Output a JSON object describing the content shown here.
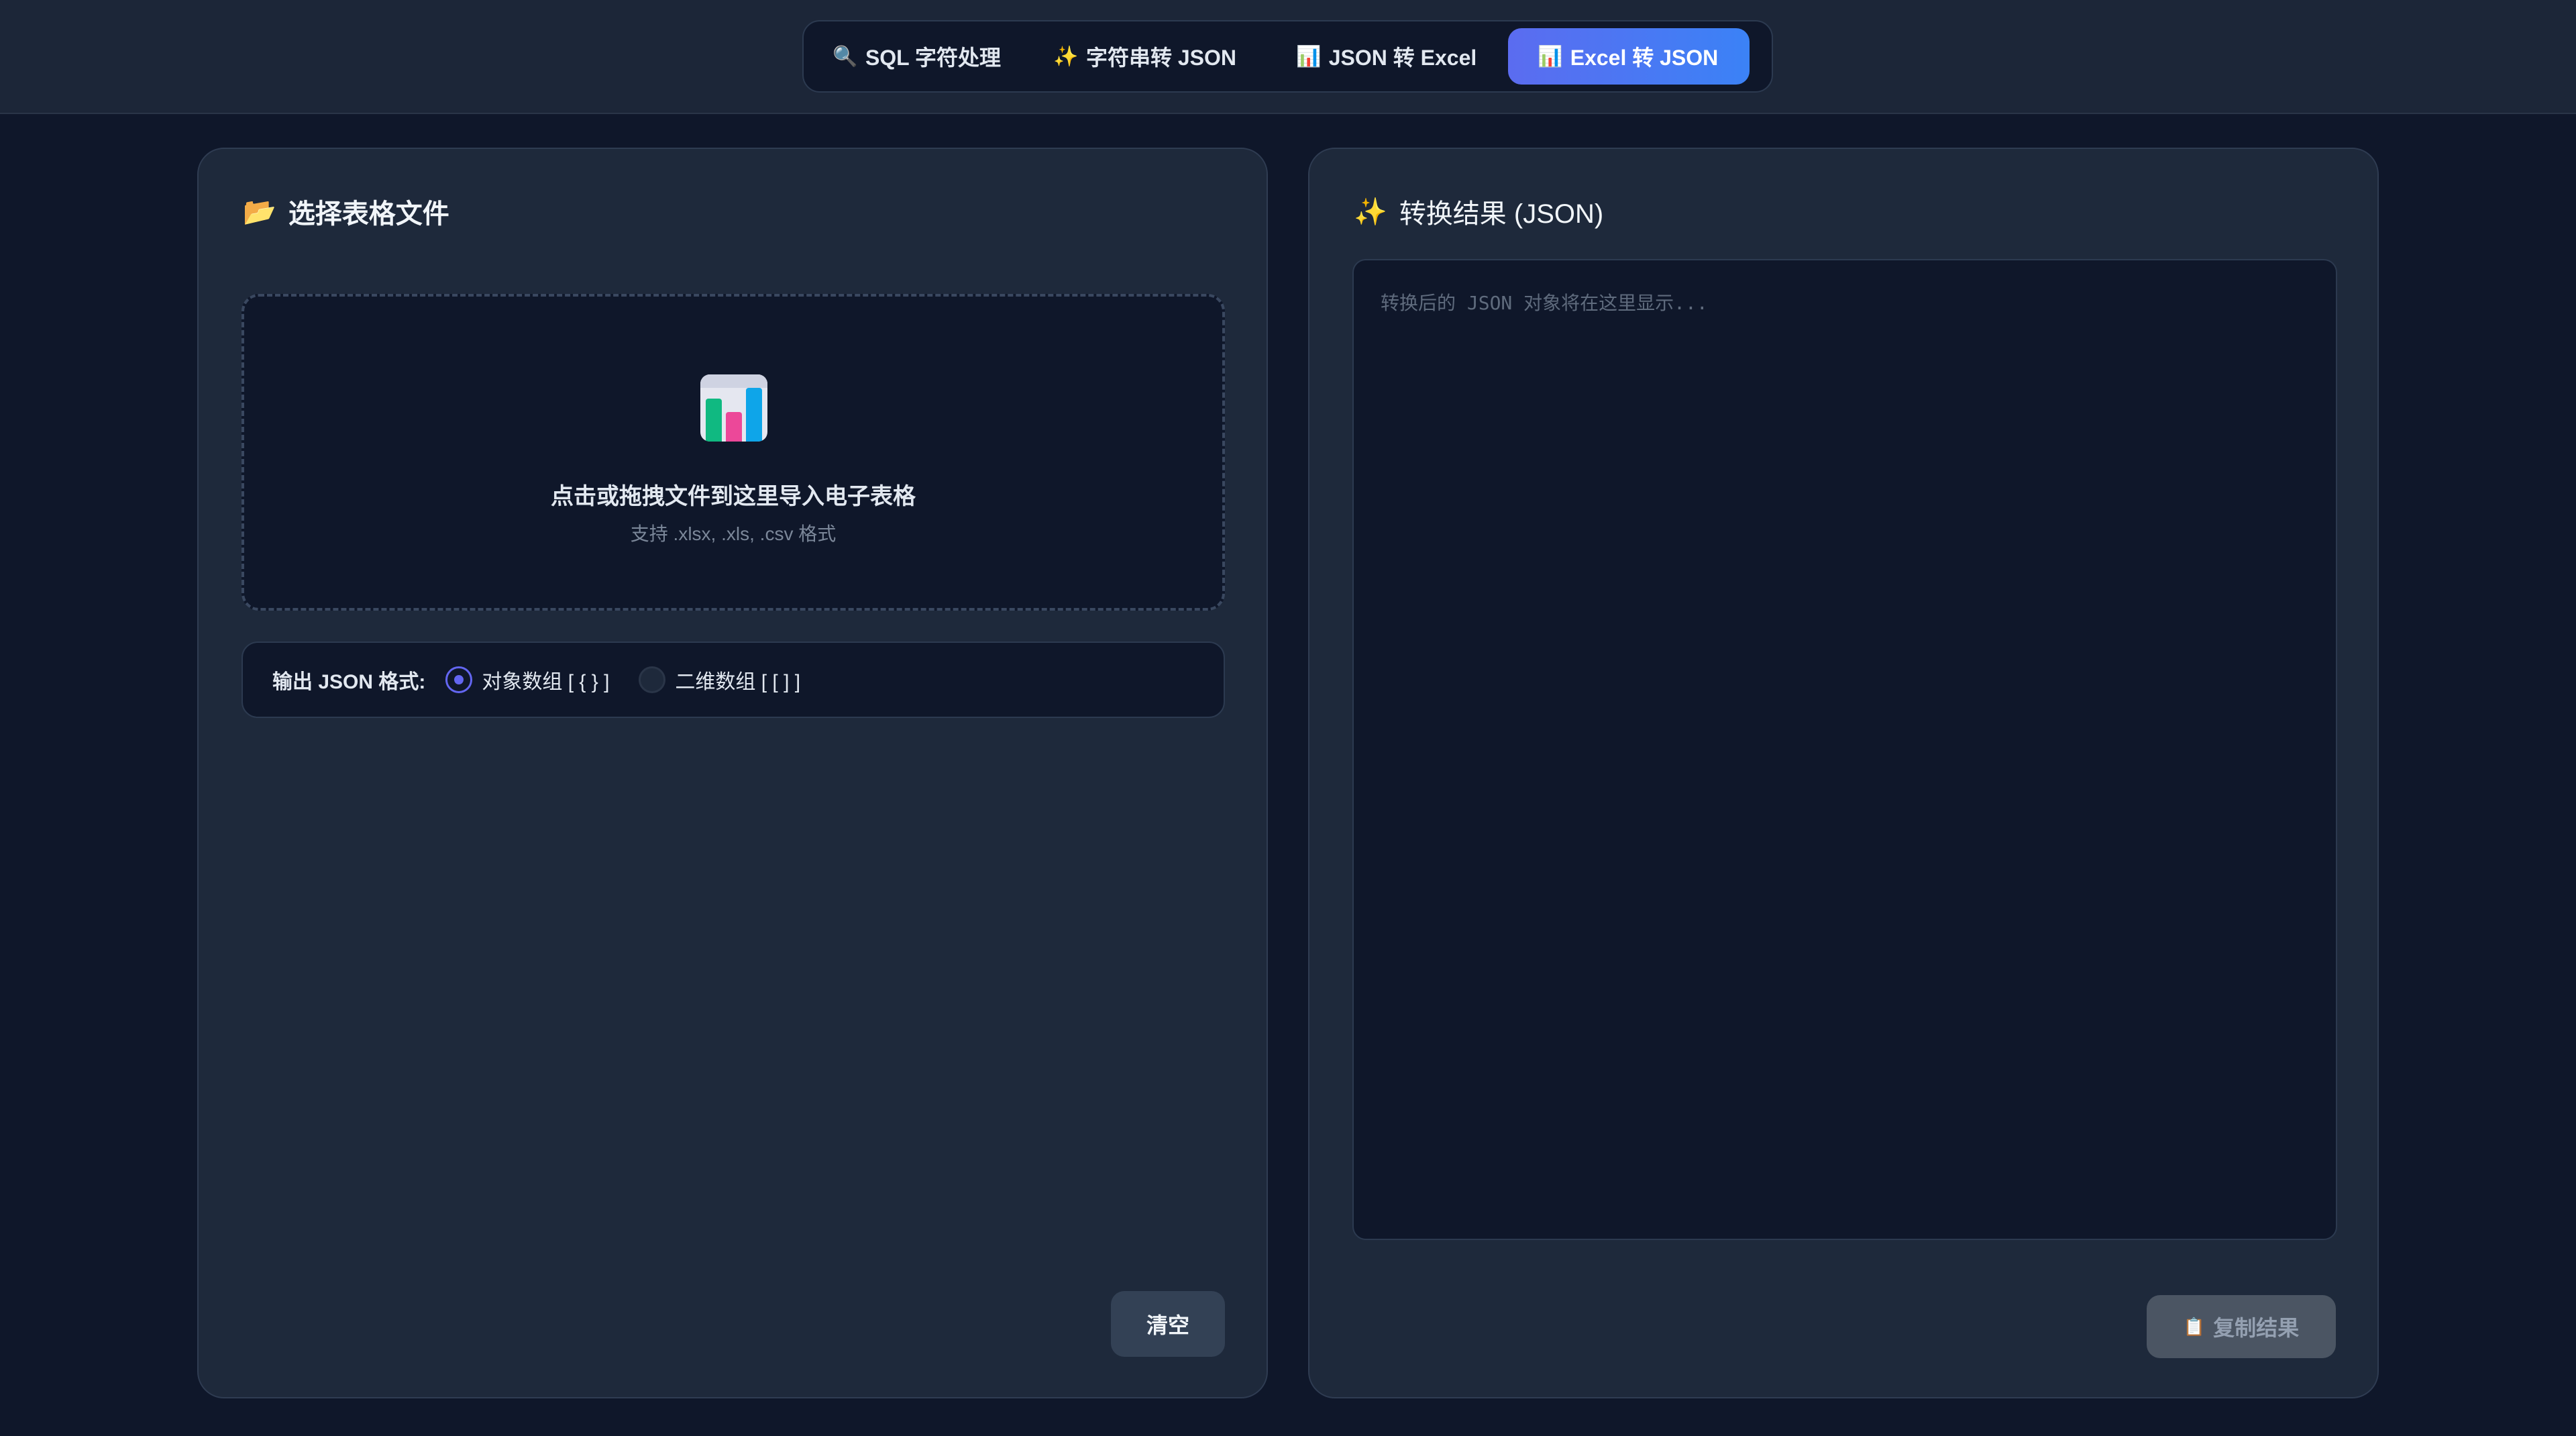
{
  "tabs": [
    {
      "label": "SQL 字符处理",
      "icon": "🔍",
      "active": false
    },
    {
      "label": "字符串转 JSON",
      "icon": "✨",
      "active": false
    },
    {
      "label": "JSON 转 Excel",
      "icon": "📊",
      "active": false
    },
    {
      "label": "Excel 转 JSON",
      "icon": "📊",
      "active": true
    }
  ],
  "left_panel": {
    "title": "选择表格文件",
    "title_icon": "📂",
    "dropzone": {
      "icon": "bar-chart-icon",
      "title": "点击或拖拽文件到这里导入电子表格",
      "subtitle": "支持 .xlsx, .xls, .csv 格式"
    },
    "format": {
      "label": "输出 JSON 格式:",
      "options": [
        {
          "label": "对象数组 [ { } ]",
          "checked": true
        },
        {
          "label": "二维数组 [ [ ] ]",
          "checked": false
        }
      ]
    },
    "clear_label": "清空"
  },
  "right_panel": {
    "title": "转换结果 (JSON)",
    "title_icon": "✨",
    "placeholder": "转换后的 JSON 对象将在这里显示...",
    "copy_icon": "📋",
    "copy_label": "复制结果"
  },
  "colors": {
    "background": "#0f172a",
    "panel": "#1e293b",
    "accent_start": "#5b6cf0",
    "accent_end": "#3b82f6"
  }
}
